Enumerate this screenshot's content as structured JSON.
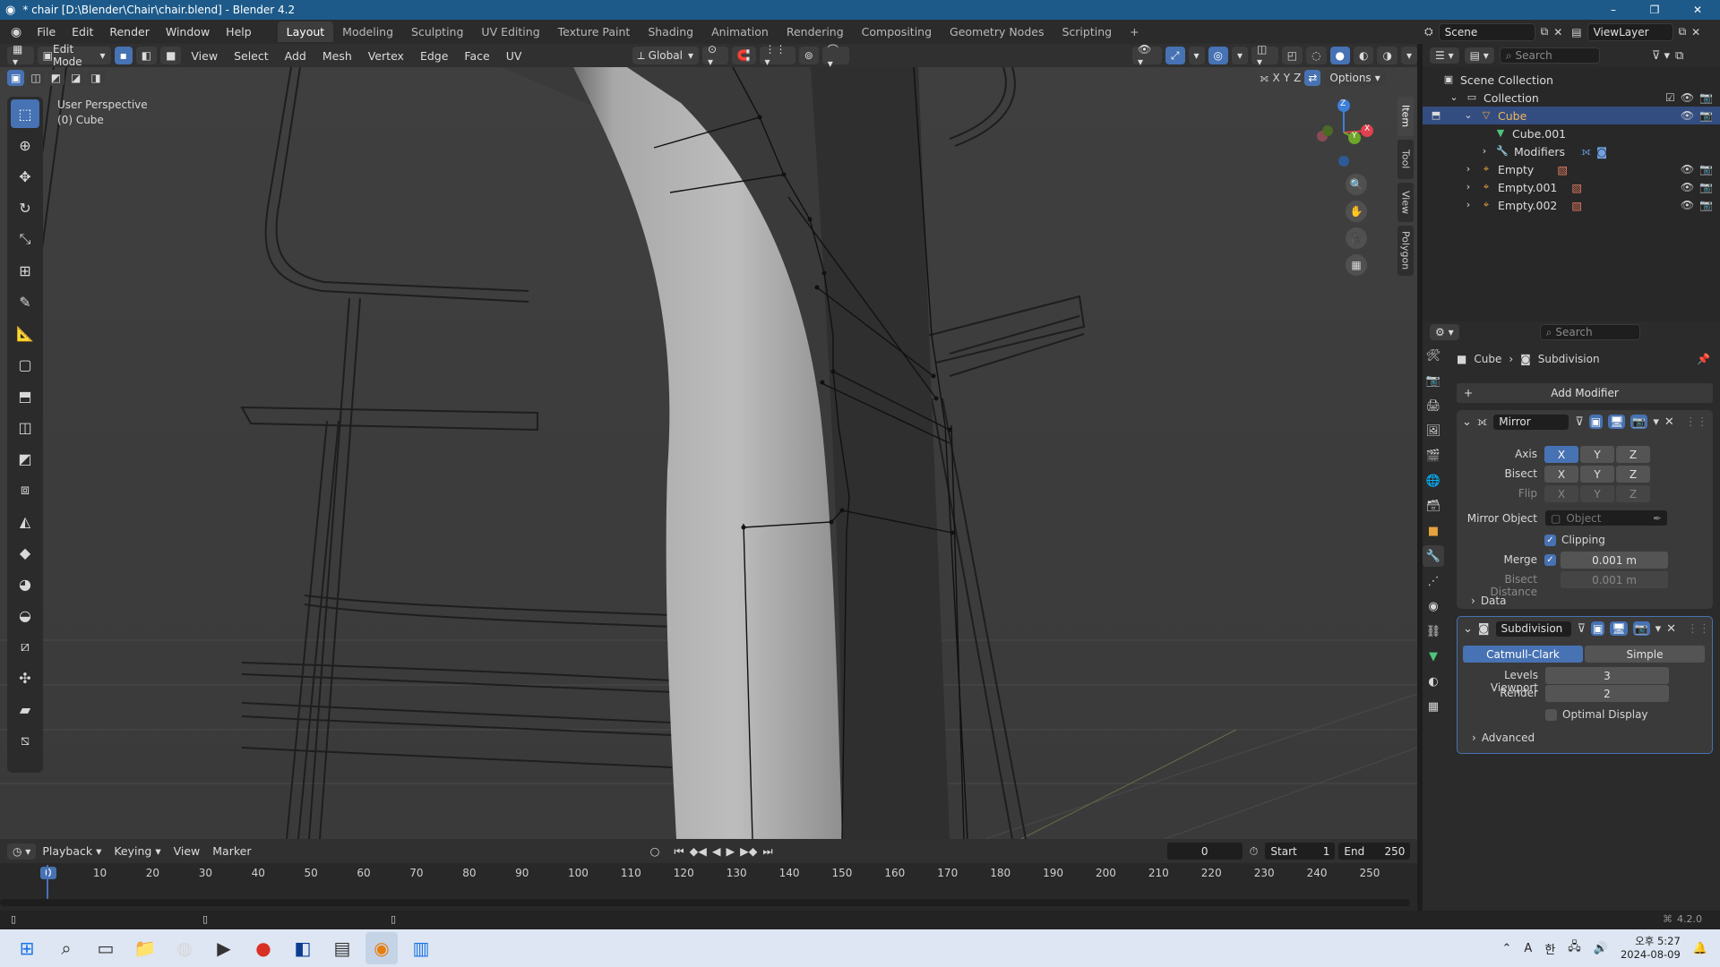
{
  "window": {
    "title": "* chair [D:\\Blender\\Chair\\chair.blend] - Blender 4.2",
    "minimize": "–",
    "maximize": "❐",
    "close": "✕"
  },
  "menubar": {
    "menus": [
      "File",
      "Edit",
      "Render",
      "Window",
      "Help"
    ],
    "workspaces": [
      "Layout",
      "Modeling",
      "Sculpting",
      "UV Editing",
      "Texture Paint",
      "Shading",
      "Animation",
      "Rendering",
      "Compositing",
      "Geometry Nodes",
      "Scripting"
    ],
    "active_workspace": "Layout",
    "add_tab": "+",
    "scene": "Scene",
    "view_layer": "ViewLayer"
  },
  "viewport_header": {
    "mode": "Edit Mode",
    "menus": [
      "View",
      "Select",
      "Add",
      "Mesh",
      "Vertex",
      "Edge",
      "Face",
      "UV"
    ],
    "orientation": "Global",
    "options": "Options",
    "axes": [
      "X",
      "Y",
      "Z"
    ]
  },
  "viewport": {
    "view_name": "User Perspective",
    "object_name": "(0) Cube",
    "side_tabs": [
      "Item",
      "Tool",
      "View",
      "Polygon"
    ],
    "gizmo": {
      "x": "X",
      "y": "Y",
      "z": "Z"
    }
  },
  "outliner": {
    "search_placeholder": "Search",
    "scene_collection": "Scene Collection",
    "items": [
      {
        "label": "Collection",
        "indent": 1
      },
      {
        "label": "Cube",
        "indent": 2,
        "selected": true
      },
      {
        "label": "Cube.001",
        "indent": 3
      },
      {
        "label": "Modifiers",
        "indent": 3
      },
      {
        "label": "Empty",
        "indent": 2
      },
      {
        "label": "Empty.001",
        "indent": 2
      },
      {
        "label": "Empty.002",
        "indent": 2
      }
    ]
  },
  "properties": {
    "search_placeholder": "Search",
    "breadcrumb": {
      "object": "Cube",
      "modifier": "Subdivision"
    },
    "add_modifier": "Add Modifier",
    "mirror": {
      "name": "Mirror",
      "axis_label": "Axis",
      "bisect_label": "Bisect",
      "flip_label": "Flip",
      "axis_buttons": [
        "X",
        "Y",
        "Z"
      ],
      "mirror_object_label": "Mirror Object",
      "mirror_object_placeholder": "Object",
      "clipping_label": "Clipping",
      "merge_label": "Merge",
      "merge_value": "0.001 m",
      "bisect_distance_label": "Bisect Distance",
      "bisect_distance_value": "0.001 m",
      "data_label": "Data"
    },
    "subdivision": {
      "name": "Subdivision",
      "catmull": "Catmull-Clark",
      "simple": "Simple",
      "levels_viewport_label": "Levels Viewport",
      "levels_viewport_value": "3",
      "render_label": "Render",
      "render_value": "2",
      "optimal_display_label": "Optimal Display",
      "advanced_label": "Advanced"
    }
  },
  "timeline": {
    "menus": [
      "Playback",
      "Keying",
      "View",
      "Marker"
    ],
    "current_frame": "0",
    "start_label": "Start",
    "start_value": "1",
    "end_label": "End",
    "end_value": "250",
    "ticks": [
      "0",
      "10",
      "20",
      "30",
      "40",
      "50",
      "60",
      "70",
      "80",
      "90",
      "100",
      "110",
      "120",
      "130",
      "140",
      "150",
      "160",
      "170",
      "180",
      "190",
      "200",
      "210",
      "220",
      "230",
      "240",
      "250"
    ]
  },
  "statusbar": {
    "version": "4.2.0"
  },
  "taskbar": {
    "ime": "A",
    "ime2": "한",
    "time": "오후 5:27",
    "date": "2024-08-09"
  },
  "colors": {
    "accent": "#4772b3",
    "title_bar": "#1d5a89",
    "viewport_bg": "#3d3d3d",
    "axis_x": "#e0414f",
    "axis_y": "#6fa52a",
    "axis_z": "#3d7fd9"
  }
}
